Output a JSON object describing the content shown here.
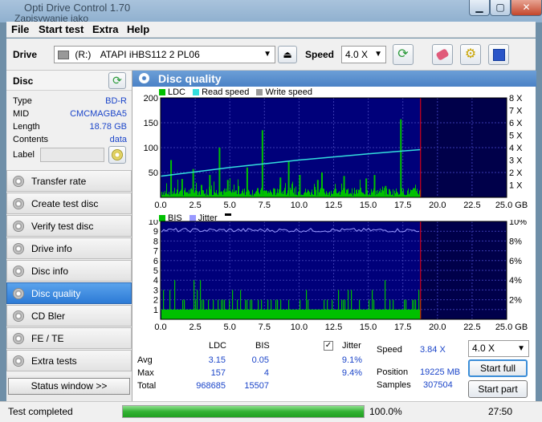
{
  "window": {
    "title": "Opti Drive Control 1.70",
    "subtitle": "Zapisywanie jako"
  },
  "menu": [
    "File",
    "Start test",
    "Extra",
    "Help"
  ],
  "drivebar": {
    "drive_label": "Drive",
    "drive_letter": "(R:)",
    "drive_name": "ATAPI iHBS112  2 PL06",
    "speed_label": "Speed",
    "speed_value": "4.0 X"
  },
  "disc": {
    "header": "Disc",
    "type_k": "Type",
    "type_v": "BD-R",
    "mid_k": "MID",
    "mid_v": "CMCMAGBA5",
    "length_k": "Length",
    "length_v": "18.78 GB",
    "contents_k": "Contents",
    "contents_v": "data",
    "label_k": "Label",
    "label_v": ""
  },
  "nav": [
    {
      "label": "Transfer rate"
    },
    {
      "label": "Create test disc"
    },
    {
      "label": "Verify test disc"
    },
    {
      "label": "Drive info"
    },
    {
      "label": "Disc info"
    },
    {
      "label": "Disc quality"
    },
    {
      "label": "CD Bler"
    },
    {
      "label": "FE / TE"
    },
    {
      "label": "Extra tests"
    }
  ],
  "status_window_btn": "Status window >>",
  "panel_title": "Disc quality",
  "colors": {
    "ldc": "#00c000",
    "read_speed": "#33dddd",
    "write_speed": "#999999",
    "bis": "#00c000",
    "jitter": "#9999ff",
    "plot_bg": "#00007a",
    "plot_bg_dark": "#00004a",
    "accent_red": "#ff0000"
  },
  "chart_data": [
    {
      "type": "bar",
      "name": "ldc-chart",
      "legend": [
        "LDC",
        "Read speed",
        "Write speed"
      ],
      "x_ticks": [
        "0.0",
        "2.5",
        "5.0",
        "7.5",
        "10.0",
        "12.5",
        "15.0",
        "17.5",
        "20.0",
        "22.5",
        "25.0 GB"
      ],
      "y_ticks_left": [
        "200",
        "150",
        "100",
        "50"
      ],
      "y_ticks_right": [
        "8 X",
        "7 X",
        "6 X",
        "5 X",
        "4 X",
        "3 X",
        "2 X",
        "1 X"
      ],
      "xlim": [
        0,
        25
      ],
      "ylim": [
        0,
        200
      ],
      "data_end_gb": 18.78,
      "spikes": [
        [
          0.7,
          75
        ],
        [
          1.5,
          37
        ],
        [
          2.3,
          57
        ],
        [
          2.9,
          25
        ],
        [
          3.5,
          45
        ],
        [
          4.2,
          100
        ],
        [
          4.8,
          35
        ],
        [
          6.2,
          60
        ],
        [
          7.3,
          135
        ],
        [
          8.6,
          40
        ],
        [
          9.2,
          72
        ],
        [
          10.0,
          45
        ],
        [
          11.3,
          35
        ],
        [
          11.6,
          50
        ],
        [
          13.2,
          43
        ],
        [
          14.8,
          38
        ],
        [
          15.4,
          45
        ],
        [
          16.2,
          23
        ],
        [
          17.3,
          157
        ]
      ],
      "read_speed": [
        [
          0,
          1.7
        ],
        [
          5,
          2.4
        ],
        [
          10,
          3.0
        ],
        [
          15,
          3.5
        ],
        [
          18.78,
          3.84
        ]
      ]
    },
    {
      "type": "bar",
      "name": "bis-chart",
      "legend": [
        "BIS",
        "Jitter"
      ],
      "x_ticks": [
        "0.0",
        "2.5",
        "5.0",
        "7.5",
        "10.0",
        "12.5",
        "15.0",
        "17.5",
        "20.0",
        "22.5",
        "25.0 GB"
      ],
      "y_ticks_left": [
        "10",
        "9",
        "8",
        "7",
        "6",
        "5",
        "4",
        "3",
        "2",
        "1"
      ],
      "y_ticks_right": [
        "10%",
        "8%",
        "6%",
        "4%",
        "2%"
      ],
      "xlim": [
        0,
        25
      ],
      "ylim": [
        0,
        10
      ],
      "jitter_avg_pct": 9.1
    }
  ],
  "stats": {
    "col_ldc": "LDC",
    "col_bis": "BIS",
    "col_jitter": "Jitter",
    "avg_label": "Avg",
    "max_label": "Max",
    "total_label": "Total",
    "avg_ldc": "3.15",
    "avg_bis": "0.05",
    "avg_jitter": "9.1%",
    "max_ldc": "157",
    "max_bis": "4",
    "max_jitter": "9.4%",
    "total_ldc": "968685",
    "total_bis": "15507",
    "jitter_checked": true
  },
  "results": {
    "speed_label": "Speed",
    "speed_value": "3.84 X",
    "position_label": "Position",
    "position_value": "19225 MB",
    "samples_label": "Samples",
    "samples_value": "307504",
    "speed_select": "4.0 X",
    "start_full": "Start full",
    "start_part": "Start part"
  },
  "statusbar": {
    "text": "Test completed",
    "progress_pct": 100,
    "progress_text": "100.0%",
    "time": "27:50"
  }
}
